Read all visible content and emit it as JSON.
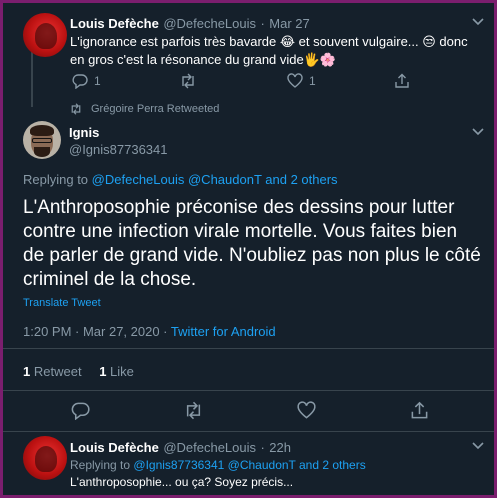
{
  "tweet1": {
    "name": "Louis Defèche",
    "handle": "@DefecheLouis",
    "separator": "·",
    "date": "Mar 27",
    "text_line1": "L'ignorance est parfois très bavarde 😂 et souvent vulgaire... 😒 donc",
    "text_line2": "en gros c'est la résonance du grand vide🖐🌸",
    "reply_count": "1",
    "like_count": "1"
  },
  "retweet_note": "Grégoire Perra Retweeted",
  "main_tweet": {
    "name": "Ignis",
    "handle": "@Ignis87736341",
    "replying_prefix": "Replying to",
    "replying_users": "@DefecheLouis @ChaudonT",
    "replying_suffix": "and 2 others",
    "text_line1": "L'Anthroposophie préconise des dessins pour lutter",
    "text_line2": "contre une infection virale mortelle.  Vous faites bien",
    "text_line3": "de parler de grand vide. N'oubliez pas non plus le côté",
    "text_line4": "criminel de la chose.",
    "translate": "Translate Tweet",
    "timestamp": "1:20 PM · Mar 27, 2020 · ",
    "source": "Twitter for Android",
    "retweet_count": "1",
    "retweet_label": "Retweet",
    "like_count": "1",
    "like_label": "Like"
  },
  "tweet3": {
    "name": "Louis Defèche",
    "handle": "@DefecheLouis",
    "separator": "·",
    "date": "22h",
    "replying_prefix": "Replying to",
    "replying_users": "@Ignis87736341 @ChaudonT",
    "replying_suffix": "and 2 others",
    "text": "L'anthroposophie... ou ça? Soyez précis..."
  },
  "colors": {
    "background": "#15202b",
    "border": "#7b1e6e",
    "link": "#1da1f2",
    "muted": "#8899a6",
    "divider": "#38444d"
  }
}
